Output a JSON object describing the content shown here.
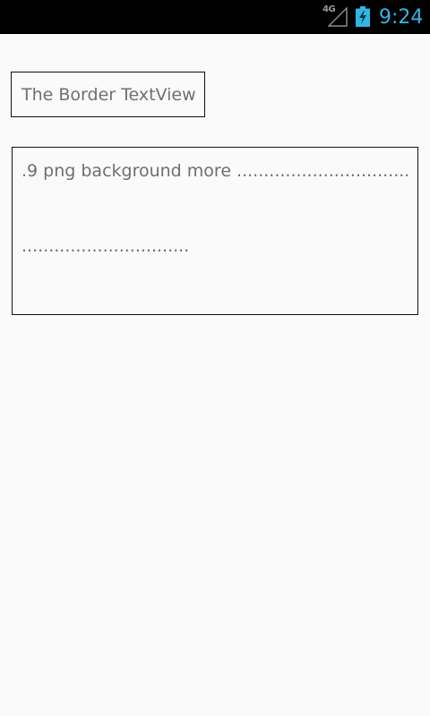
{
  "status_bar": {
    "network_type": "4G",
    "time": "9:24",
    "icons": [
      "signal-icon",
      "battery-charging-icon"
    ],
    "accent_color": "#33b5e5"
  },
  "content": {
    "border_textview_text": "The Border TextView",
    "nine_patch_line1": ".9 png background more ................................",
    "nine_patch_line2": "..............................."
  }
}
